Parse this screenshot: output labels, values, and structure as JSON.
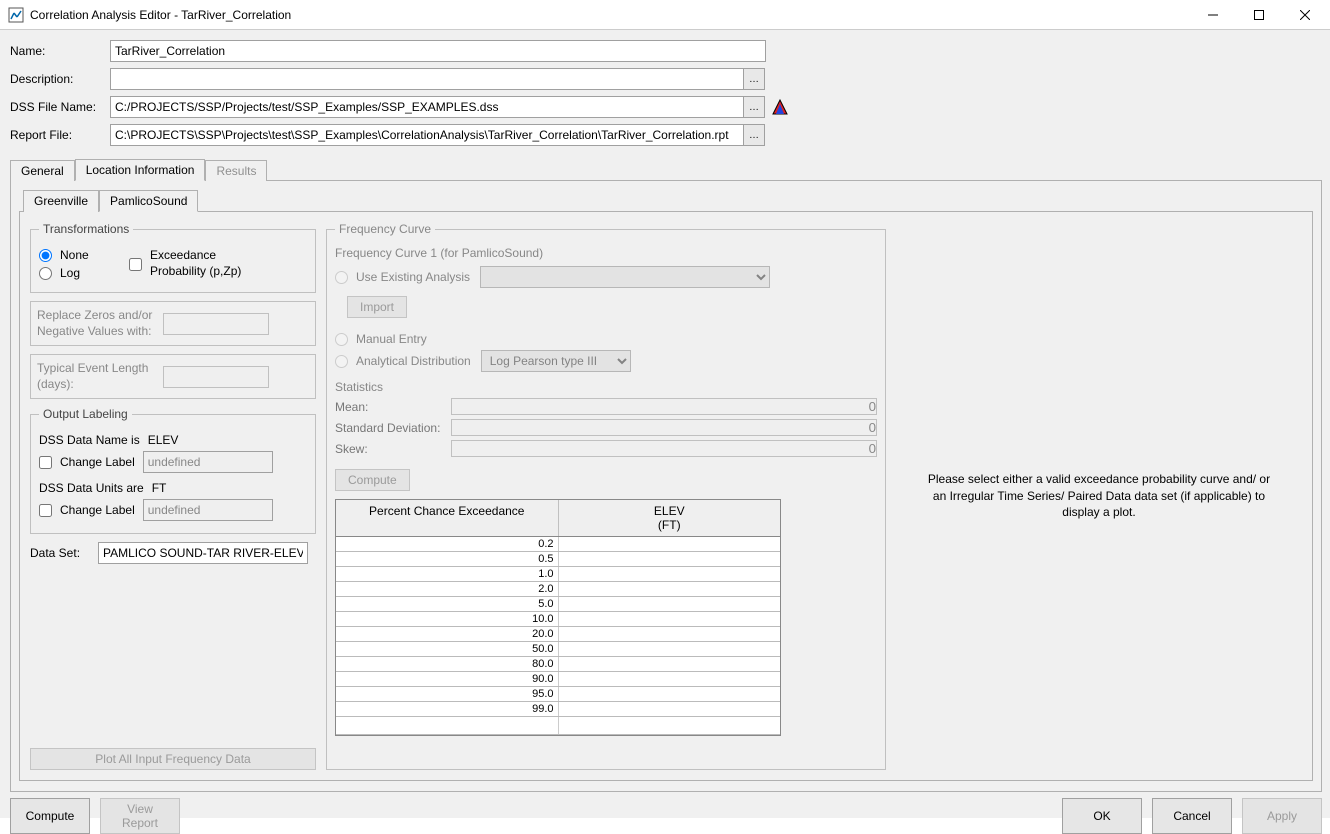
{
  "window": {
    "title": "Correlation Analysis Editor - TarRiver_Correlation"
  },
  "fields": {
    "name_label": "Name:",
    "name_value": "TarRiver_Correlation",
    "desc_label": "Description:",
    "desc_value": "",
    "dssfile_label": "DSS File Name:",
    "dssfile_value": "C:/PROJECTS/SSP/Projects/test/SSP_Examples/SSP_EXAMPLES.dss",
    "report_label": "Report File:",
    "report_value": "C:\\PROJECTS\\SSP\\Projects\\test\\SSP_Examples\\CorrelationAnalysis\\TarRiver_Correlation\\TarRiver_Correlation.rpt"
  },
  "tabs": {
    "general": "General",
    "location": "Location Information",
    "results": "Results",
    "sub_greenville": "Greenville",
    "sub_pamlico": "PamlicoSound"
  },
  "transform": {
    "legend": "Transformations",
    "none": "None",
    "log": "Log",
    "exceed": "Exceedance Probability (p,Zp)",
    "replace_label": "Replace Zeros and/or Negative Values with:",
    "typical_label": "Typical Event Length (days):"
  },
  "output_labeling": {
    "legend": "Output Labeling",
    "dss_name_is": "DSS Data Name is",
    "dss_name_val": "ELEV",
    "change_label": "Change Label",
    "undefined": "undefined",
    "dss_units_are": "DSS Data Units are",
    "dss_units_val": "FT"
  },
  "dataset": {
    "label": "Data Set:",
    "value": "PAMLICO SOUND-TAR RIVER-ELEV"
  },
  "plot_all_btn": "Plot All Input Frequency Data",
  "freq": {
    "legend": "Frequency Curve",
    "fc1": "Frequency Curve 1 (for PamlicoSound)",
    "use_existing": "Use Existing Analysis",
    "import": "Import",
    "manual": "Manual Entry",
    "analytical": "Analytical Distribution",
    "dist_selected": "Log Pearson type III",
    "stats": "Statistics",
    "mean": "Mean:",
    "std": "Standard Deviation:",
    "skew": "Skew:",
    "zero": "0",
    "compute": "Compute",
    "col1": "Percent Chance Exceedance",
    "col2a": "ELEV",
    "col2b": "(FT)"
  },
  "chart_data": {
    "type": "table",
    "columns": [
      "Percent Chance Exceedance",
      "ELEV (FT)"
    ],
    "rows": [
      {
        "pce": "0.2",
        "elev": ""
      },
      {
        "pce": "0.5",
        "elev": ""
      },
      {
        "pce": "1.0",
        "elev": ""
      },
      {
        "pce": "2.0",
        "elev": ""
      },
      {
        "pce": "5.0",
        "elev": ""
      },
      {
        "pce": "10.0",
        "elev": ""
      },
      {
        "pce": "20.0",
        "elev": ""
      },
      {
        "pce": "50.0",
        "elev": ""
      },
      {
        "pce": "80.0",
        "elev": ""
      },
      {
        "pce": "90.0",
        "elev": ""
      },
      {
        "pce": "95.0",
        "elev": ""
      },
      {
        "pce": "99.0",
        "elev": ""
      }
    ]
  },
  "right_msg": "Please select either a valid exceedance probability curve and/ or an Irregular Time Series/ Paired Data data set (if applicable) to display a plot.",
  "buttons": {
    "compute": "Compute",
    "view_report": "View Report",
    "ok": "OK",
    "cancel": "Cancel",
    "apply": "Apply"
  }
}
